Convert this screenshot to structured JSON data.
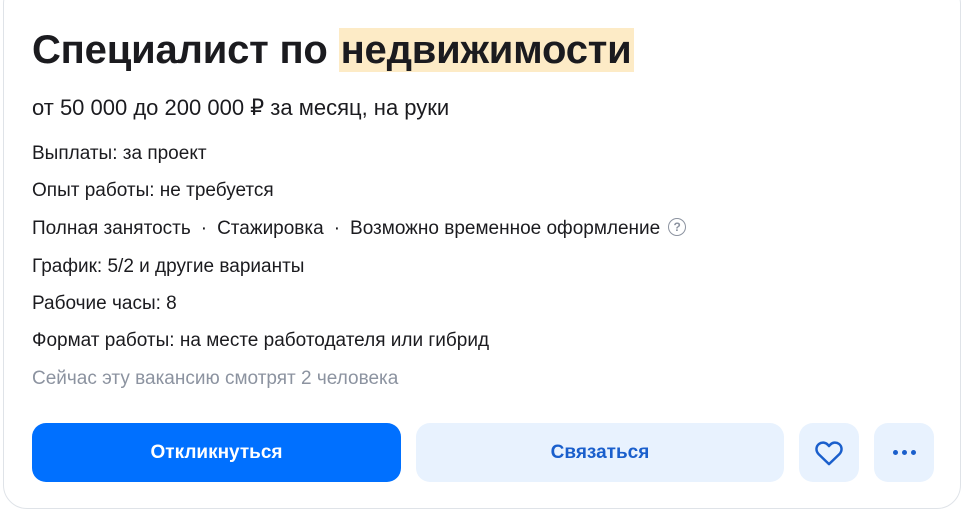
{
  "vacancy": {
    "title_prefix": "Специалист по",
    "title_highlight": "недвижимости",
    "salary": "от 50 000 до 200 000 ₽ за месяц, на руки",
    "payments": "Выплаты: за проект",
    "experience": "Опыт работы: не требуется",
    "employment_tags": [
      "Полная занятость",
      "Стажировка",
      "Возможно временное оформление"
    ],
    "employment_separator": "·",
    "schedule": "График: 5/2 и другие варианты",
    "hours": "Рабочие часы: 8",
    "work_format": "Формат работы: на месте работодателя или гибрид",
    "viewers": "Сейчас эту вакансию смотрят 2 человека"
  },
  "actions": {
    "respond_label": "Откликнуться",
    "contact_label": "Связаться",
    "favorite_icon": "heart-icon",
    "more_icon": "more-dots-icon"
  },
  "icons": {
    "help_glyph": "?"
  },
  "colors": {
    "primary": "#0070ff",
    "secondary_bg": "#e8f2fe",
    "secondary_text": "#1a5fcc",
    "highlight": "#fdebc6",
    "muted_text": "#8c93a0"
  }
}
